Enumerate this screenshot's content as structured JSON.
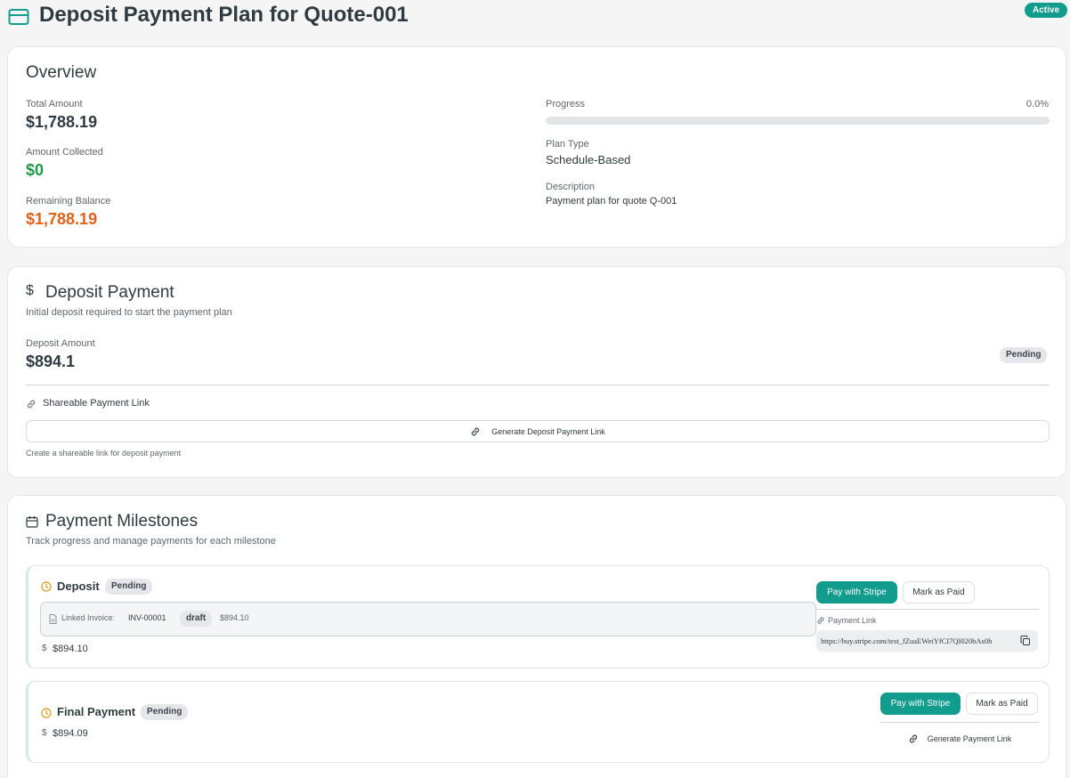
{
  "header": {
    "title": "Deposit Payment Plan for Quote-001",
    "status": "Active",
    "icon": "credit-card-icon"
  },
  "overview": {
    "title": "Overview",
    "total_label": "Total Amount",
    "total_value": "$1,788.19",
    "collected_label": "Amount Collected",
    "collected_value": "$0",
    "remaining_label": "Remaining Balance",
    "remaining_value": "$1,788.19",
    "progress_label": "Progress",
    "progress_text": "0.0%",
    "progress_fraction": 0.0,
    "plan_type_label": "Plan Type",
    "plan_type_value": "Schedule-Based",
    "description_label": "Description",
    "description_value": "Payment plan for quote Q-001"
  },
  "deposit": {
    "title": "Deposit Payment",
    "icon": "dollar-icon",
    "subtitle": "Initial deposit required to start the payment plan",
    "amount_label": "Deposit Amount",
    "amount_value": "$894.1",
    "status": "Pending",
    "link_title": "Shareable Payment Link",
    "generate_button": "Generate Deposit Payment Link",
    "help_text": "Create a shareable link for deposit payment"
  },
  "milestones": {
    "title": "Payment Milestones",
    "icon": "calendar-icon",
    "subtitle": "Track progress and manage payments for each milestone",
    "items": [
      {
        "name": "Deposit",
        "status": "Pending",
        "invoice_label": "Linked Invoice:",
        "invoice_number": "INV-00001",
        "invoice_status": "draft",
        "invoice_amount": "$894.10",
        "amount": "$894.10",
        "pay_button": "Pay with Stripe",
        "mark_paid_button": "Mark as Paid",
        "link_label": "Payment Link",
        "link_url": "https://buy.stripe.com/test_fZuaEWeiYfCI7QI020bAs0h"
      },
      {
        "name": "Final Payment",
        "status": "Pending",
        "amount": "$894.09",
        "pay_button": "Pay with Stripe",
        "mark_paid_button": "Mark as Paid",
        "generate_link_button": "Generate Payment Link"
      }
    ]
  },
  "colors": {
    "accent": "#119c8e",
    "positive": "#1f9a4a",
    "warning": "#e0621b",
    "clock": "#d99a1c"
  }
}
